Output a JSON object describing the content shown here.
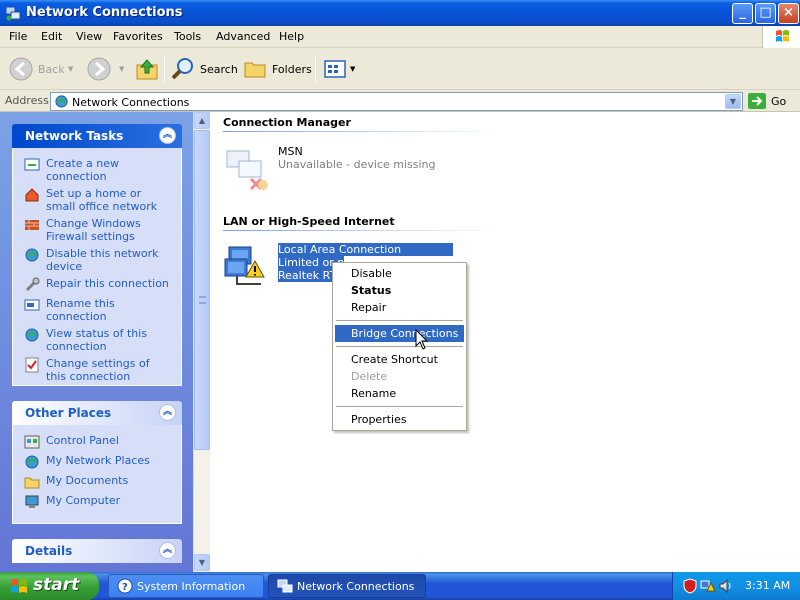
{
  "window": {
    "title": "Network Connections",
    "controls": {
      "minimize": "_",
      "maximize": "□",
      "close": "×"
    }
  },
  "menubar": {
    "items": [
      "File",
      "Edit",
      "View",
      "Favorites",
      "Tools",
      "Advanced",
      "Help"
    ]
  },
  "toolbar": {
    "back": "Back",
    "search": "Search",
    "folders": "Folders"
  },
  "address": {
    "label": "Address",
    "value": "Network Connections",
    "go": "Go"
  },
  "left_panel": {
    "network_tasks": {
      "title": "Network Tasks",
      "items": [
        {
          "label": "Create a new connection",
          "icon": "new-connection-icon"
        },
        {
          "label": "Set up a home or small office network",
          "icon": "home-network-icon"
        },
        {
          "label": "Change Windows Firewall settings",
          "icon": "firewall-icon"
        },
        {
          "label": "Disable this network device",
          "icon": "disable-device-icon"
        },
        {
          "label": "Repair this connection",
          "icon": "repair-icon"
        },
        {
          "label": "Rename this connection",
          "icon": "rename-icon"
        },
        {
          "label": "View status of this connection",
          "icon": "status-icon"
        },
        {
          "label": "Change settings of this connection",
          "icon": "settings-icon"
        }
      ]
    },
    "other_places": {
      "title": "Other Places",
      "items": [
        {
          "label": "Control Panel",
          "icon": "control-panel-icon"
        },
        {
          "label": "My Network Places",
          "icon": "network-places-icon"
        },
        {
          "label": "My Documents",
          "icon": "documents-icon"
        },
        {
          "label": "My Computer",
          "icon": "computer-icon"
        }
      ]
    },
    "details": {
      "title": "Details"
    }
  },
  "content": {
    "groups": [
      {
        "title": "Connection Manager"
      },
      {
        "title": "LAN or High-Speed Internet"
      }
    ],
    "msn": {
      "name": "MSN",
      "status": "Unavailable - device missing"
    },
    "lan": {
      "name": "Local Area Connection",
      "status": "Limited or n",
      "device": "Realtek RT"
    }
  },
  "context_menu": {
    "items": [
      {
        "label": "Disable"
      },
      {
        "label": "Status"
      },
      {
        "label": "Repair"
      },
      {
        "label": "Bridge Connections"
      },
      {
        "label": "Create Shortcut"
      },
      {
        "label": "Delete"
      },
      {
        "label": "Rename"
      },
      {
        "label": "Properties"
      }
    ]
  },
  "taskbar": {
    "start": "start",
    "buttons": [
      {
        "label": "System Information"
      },
      {
        "label": "Network Connections"
      }
    ],
    "clock": "3:31 AM"
  },
  "colors": {
    "titlebar": "#0a5ee0",
    "selection": "#316ac5",
    "task_link": "#215dc6",
    "taskbar": "#2157d7",
    "start_green": "#3aa33a"
  }
}
